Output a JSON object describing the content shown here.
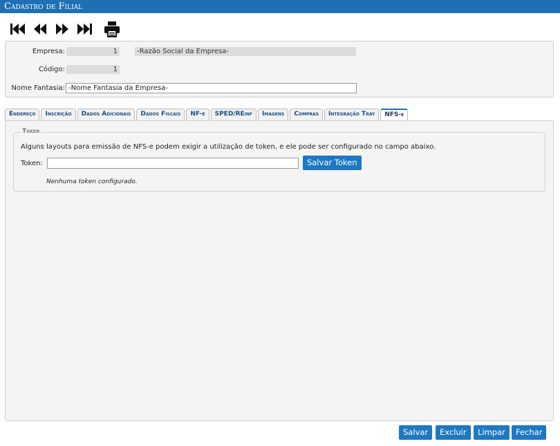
{
  "window": {
    "title": "Cadastro de Filial"
  },
  "header": {
    "empresa_label": "Empresa:",
    "empresa_code": "1",
    "empresa_name": "-Razão Social da Empresa-",
    "codigo_label": "Código:",
    "codigo_value": "1",
    "fantasia_label": "Nome Fantasia:",
    "fantasia_value": "-Nome Fantasia da Empresa-"
  },
  "tabs": [
    {
      "label": "Endereço"
    },
    {
      "label": "Inscrição"
    },
    {
      "label": "Dados Adicionais"
    },
    {
      "label": "Dados Fiscais"
    },
    {
      "label": "NF-e"
    },
    {
      "label": "SPED/REinf"
    },
    {
      "label": "Imagens"
    },
    {
      "label": "Compras"
    },
    {
      "label": "Integração Tray"
    },
    {
      "label": "NFS-e"
    }
  ],
  "active_tab": "NFS-e",
  "token_section": {
    "legend": "Token",
    "info": "Alguns layouts para emissão de NFS-e podem exigir a utilização de token, e ele pode ser configurado no campo abaixo.",
    "label": "Token:",
    "value": "",
    "save_button": "Salvar Token",
    "note": "Nenhuma token configurado."
  },
  "footer": {
    "save": "Salvar",
    "delete": "Excluir",
    "clear": "Limpar",
    "close": "Fechar"
  },
  "colors": {
    "accent": "#1e78c2",
    "titlebar": "#1e6fb4"
  },
  "icons": [
    "first-record-icon",
    "previous-record-icon",
    "next-record-icon",
    "last-record-icon",
    "print-icon"
  ]
}
